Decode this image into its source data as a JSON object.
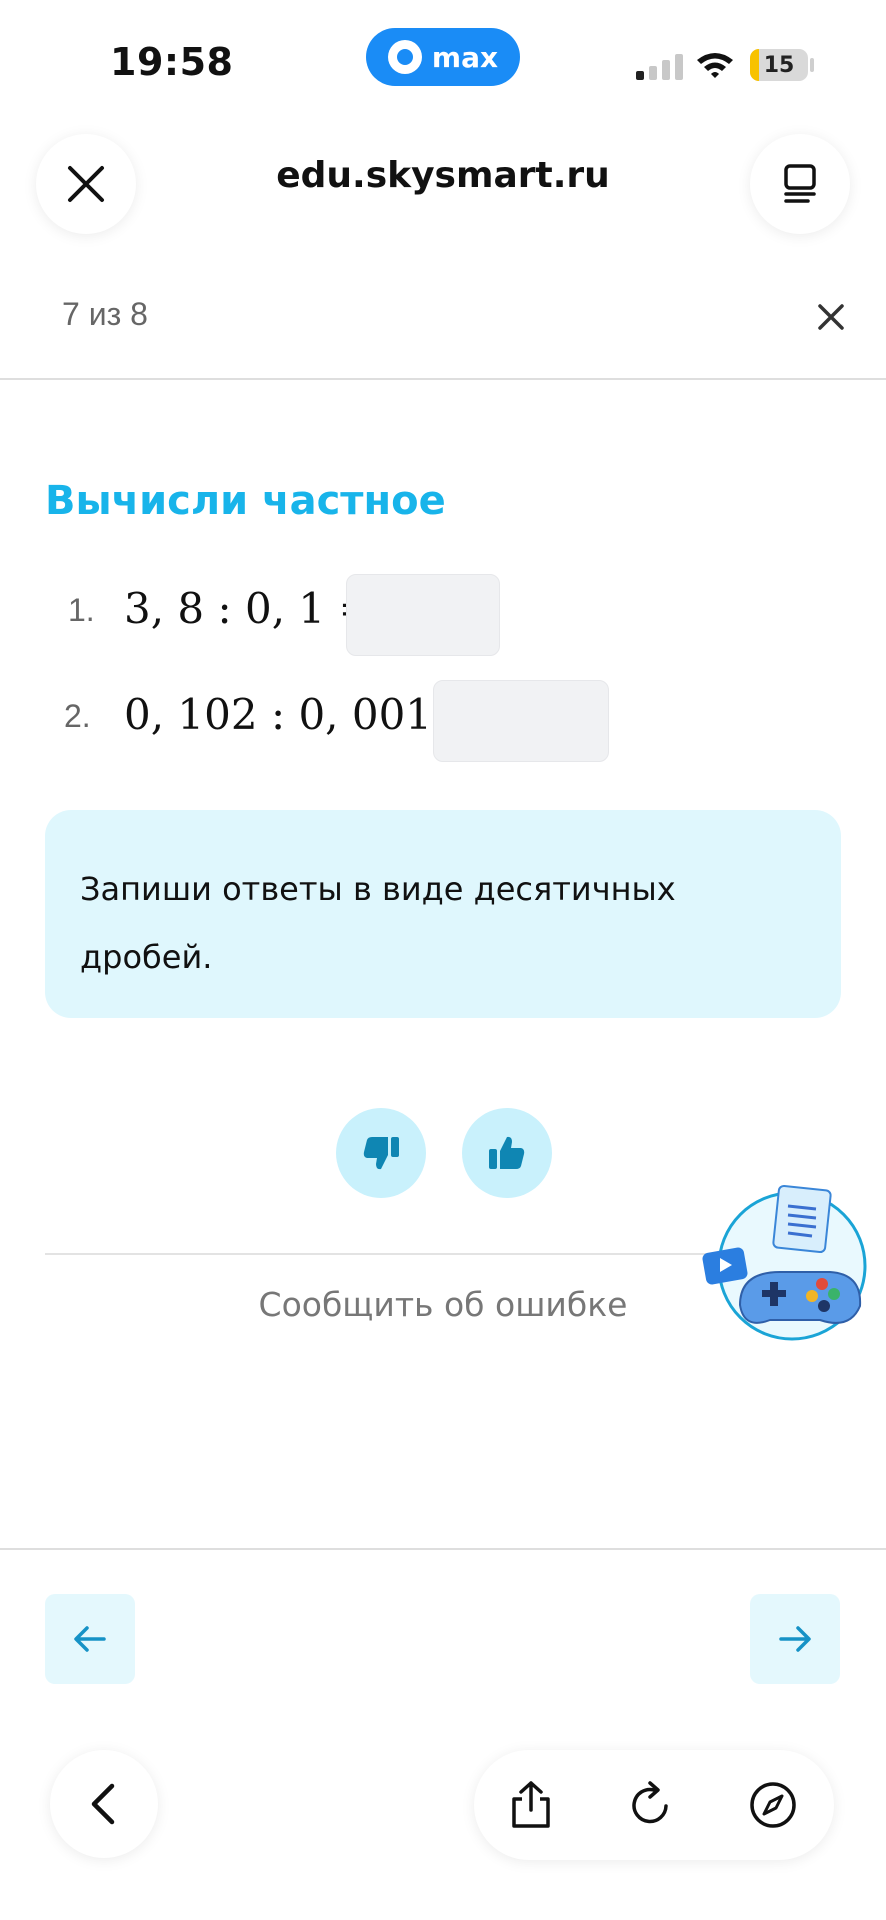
{
  "status_bar": {
    "time": "19:58",
    "app_pill": "max",
    "battery": "15",
    "battery_level": 0.15
  },
  "browser": {
    "domain": "edu.skysmart.ru",
    "close_icon": "close-icon",
    "tabs_icon": "tabs-icon"
  },
  "progress": {
    "label": "7 из 8"
  },
  "task": {
    "title": "Вычисли частное",
    "items": [
      {
        "number": "1.",
        "expression": "3, 8 : 0, 1 =",
        "answer": ""
      },
      {
        "number": "2.",
        "expression": "0, 102 : 0, 001 =",
        "answer": ""
      }
    ],
    "hint": "Запиши ответы в виде десятичных дробей."
  },
  "feedback": {
    "dislike_icon": "thumbs-down-icon",
    "like_icon": "thumbs-up-icon",
    "report_label": "Сообщить об ошибке"
  },
  "navigation": {
    "prev_icon": "arrow-left-icon",
    "next_icon": "arrow-right-icon"
  },
  "browser_toolbar": {
    "back_icon": "chevron-left-icon",
    "share_icon": "share-icon",
    "reload_icon": "reload-icon",
    "compass_icon": "compass-icon"
  },
  "colors": {
    "accent": "#18b4ea",
    "hint_bg": "#dff7fd",
    "button_bg": "#c9f1fc",
    "max_brand": "#1a8cf6"
  }
}
